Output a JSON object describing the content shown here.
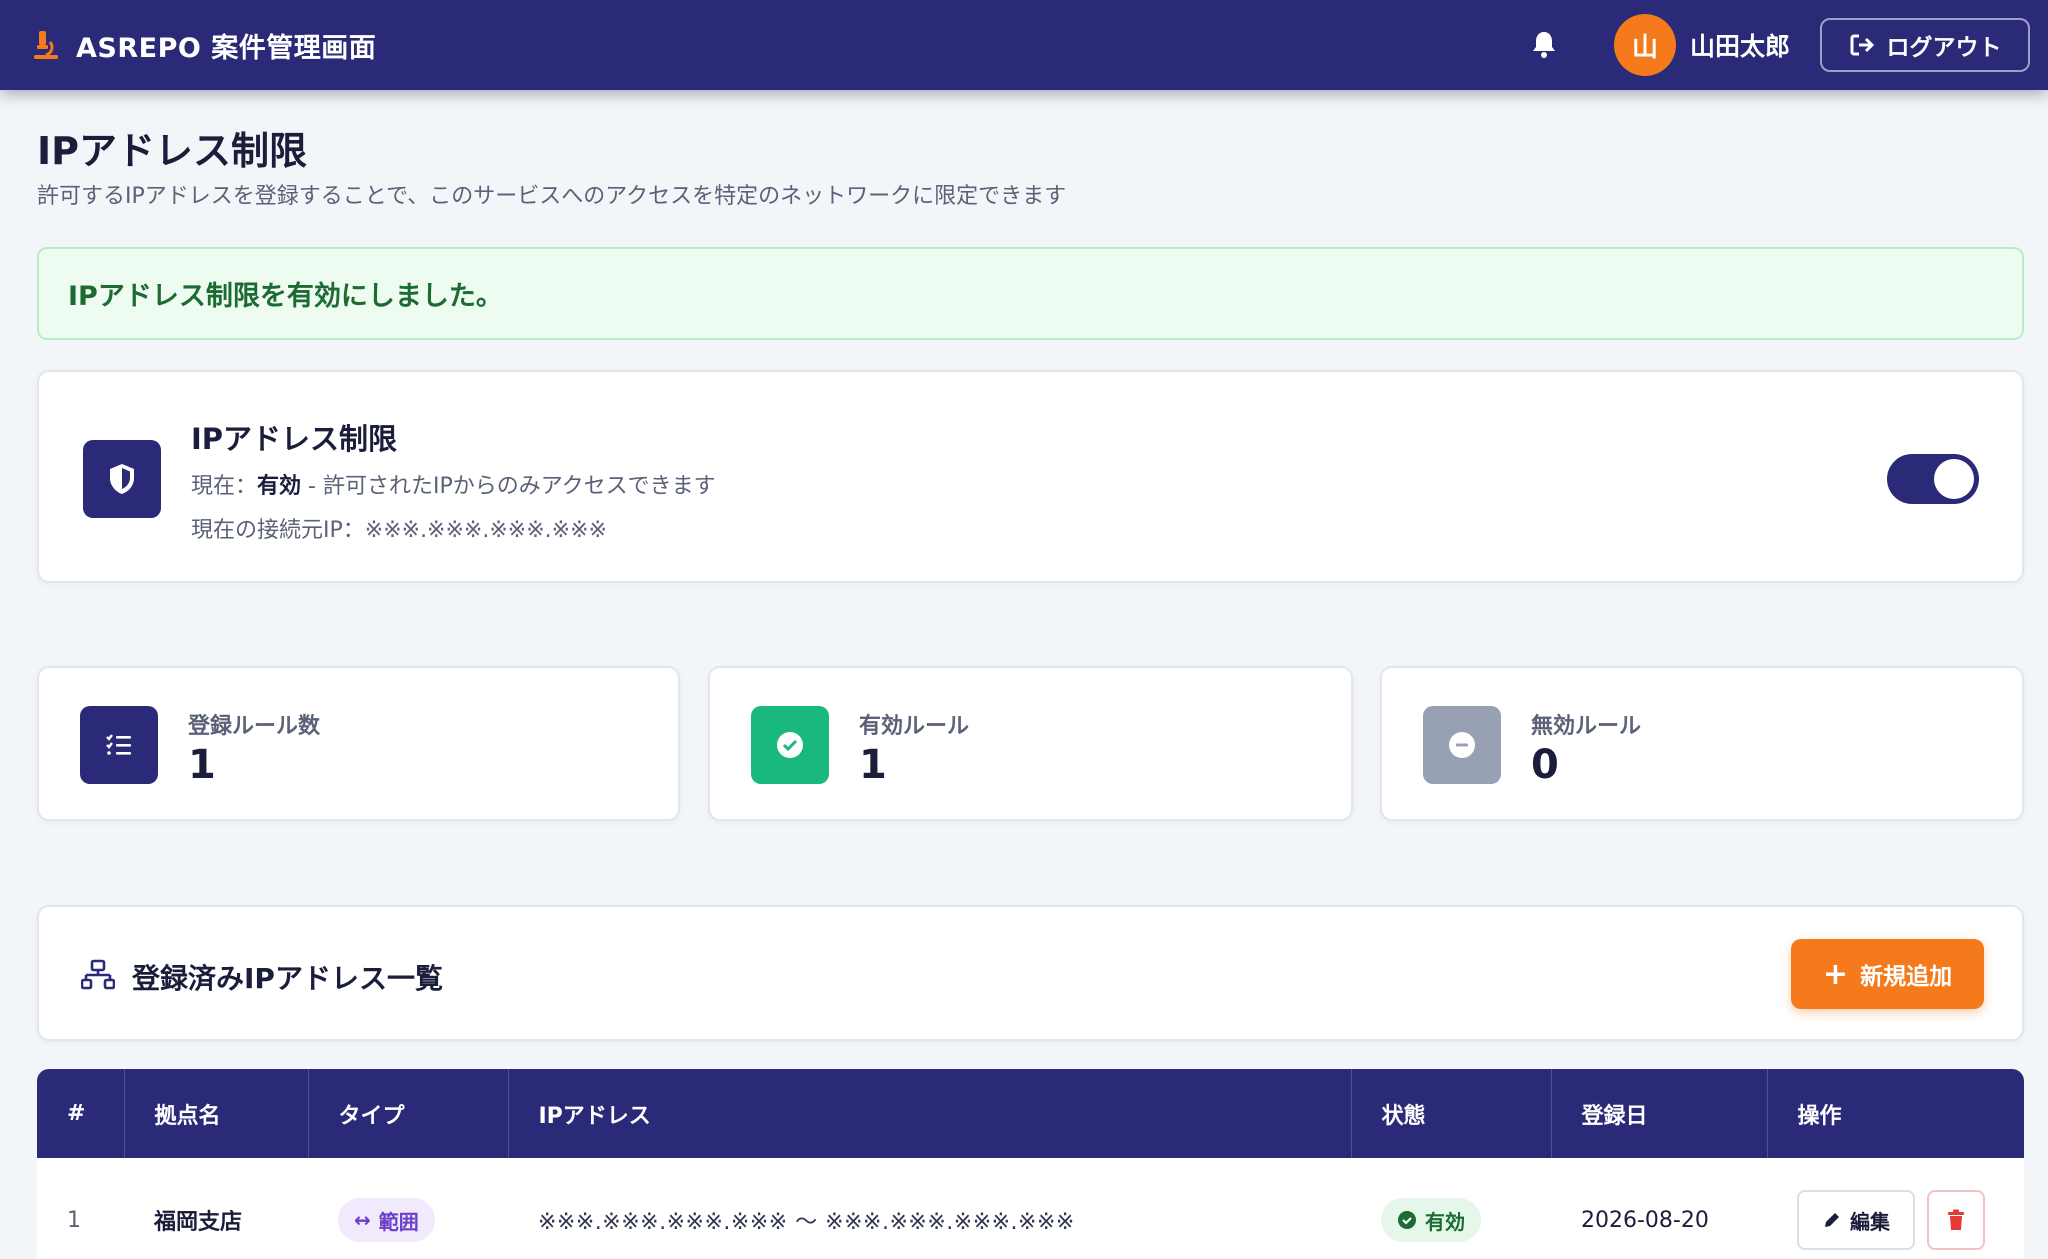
{
  "header": {
    "app_title": "ASREPO 案件管理画面",
    "user_initial": "山",
    "user_name": "山田太郎",
    "logout_label": "ログアウト"
  },
  "page": {
    "title": "IPアドレス制限",
    "subtitle": "許可するIPアドレスを登録することで、このサービスへのアクセスを特定のネットワークに限定できます"
  },
  "alert": {
    "message": "IPアドレス制限を有効にしました。"
  },
  "restriction": {
    "title": "IPアドレス制限",
    "status_prefix": "現在：",
    "status_value": "有効",
    "status_desc": " - 許可されたIPからのみアクセスできます",
    "current_ip_label": "現在の接続元IP：",
    "current_ip": "※※※.※※※.※※※.※※※",
    "enabled": true
  },
  "stats": [
    {
      "label": "登録ルール数",
      "value": "1",
      "color": "#2a2a78"
    },
    {
      "label": "有効ルール",
      "value": "1",
      "color": "#19b87e"
    },
    {
      "label": "無効ルール",
      "value": "0",
      "color": "#98a1b3"
    }
  ],
  "list": {
    "title": "登録済みIPアドレス一覧",
    "add_label": "新規追加"
  },
  "table": {
    "columns": [
      "#",
      "拠点名",
      "タイプ",
      "IPアドレス",
      "状態",
      "登録日",
      "操作"
    ],
    "rows": [
      {
        "num": "1",
        "name": "福岡支店",
        "type": "範囲",
        "ip": "※※※.※※※.※※※.※※※ 〜 ※※※.※※※.※※※.※※※",
        "status": "有効",
        "date": "2026-08-20",
        "edit_label": "編集"
      }
    ]
  },
  "colors": {
    "primary": "#2a2a78",
    "accent": "#f47a1c",
    "success": "#19b87e",
    "muted": "#98a1b3"
  }
}
